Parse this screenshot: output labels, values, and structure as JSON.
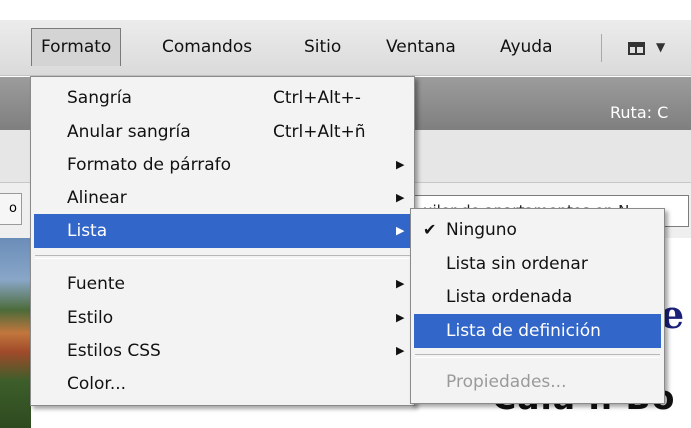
{
  "menubar": {
    "items": [
      {
        "label": "Formato"
      },
      {
        "label": "Comandos"
      },
      {
        "label": "Sitio"
      },
      {
        "label": "Ventana"
      },
      {
        "label": "Ayuda"
      }
    ],
    "layout_icon": "layout-icon",
    "layout_arrow": "▼"
  },
  "header": {
    "ruta_label": "Ruta: C"
  },
  "document": {
    "title_field_value": "uiler de apartamentos en N",
    "left_button_label": "o",
    "heading_partial": "e",
    "sub_heading_partial": "Cala n Bo"
  },
  "format_menu": {
    "items": [
      {
        "label": "Sangría",
        "shortcut": "Ctrl+Alt+-"
      },
      {
        "label": "Anular sangría",
        "shortcut": "Ctrl+Alt+ñ"
      },
      {
        "label": "Formato de párrafo",
        "arrow": "▶"
      },
      {
        "label": "Alinear",
        "arrow": "▶"
      },
      {
        "label": "Lista",
        "arrow": "▶"
      },
      {
        "label": "Fuente",
        "arrow": "▶"
      },
      {
        "label": "Estilo",
        "arrow": "▶"
      },
      {
        "label": "Estilos CSS",
        "arrow": "▶"
      },
      {
        "label": "Color..."
      }
    ]
  },
  "list_submenu": {
    "items": [
      {
        "label": "Ninguno",
        "check": "✔"
      },
      {
        "label": "Lista sin ordenar"
      },
      {
        "label": "Lista ordenada"
      },
      {
        "label": "Lista de definición"
      },
      {
        "label": "Propiedades..."
      }
    ]
  },
  "colors": {
    "highlight": "#3266c8",
    "menu_bg": "#f3f3f3",
    "disabled_text": "#9a9a9a",
    "heading_blue": "#1a1f7a"
  }
}
